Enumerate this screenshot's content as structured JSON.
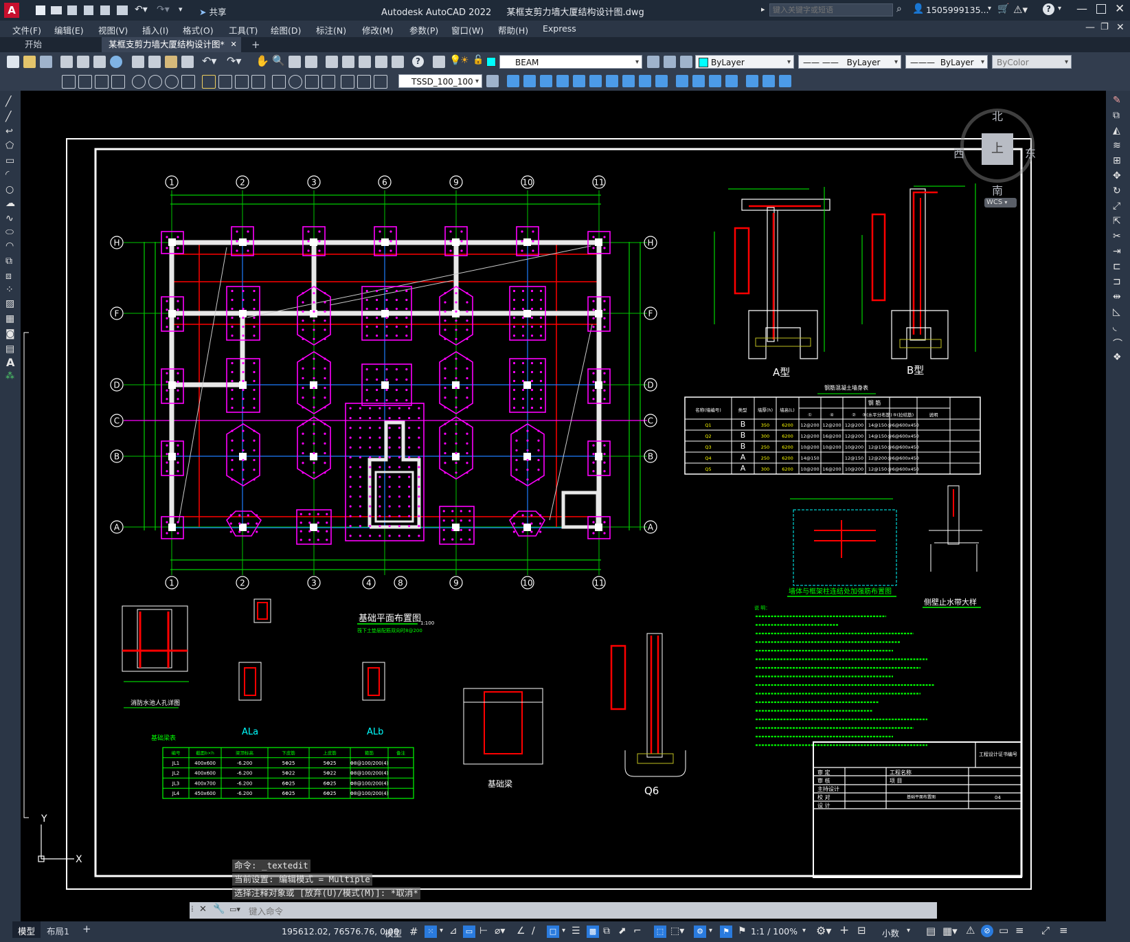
{
  "app": {
    "title": "Autodesk AutoCAD 2022",
    "filename": "某框支剪力墙大厦结构设计图.dwg",
    "search_placeholder": "键入关键字或短语",
    "user": "1505999135...",
    "share": "共享",
    "app_letter": "A"
  },
  "menu": [
    "文件(F)",
    "编辑(E)",
    "视图(V)",
    "插入(I)",
    "格式(O)",
    "工具(T)",
    "绘图(D)",
    "标注(N)",
    "修改(M)",
    "参数(P)",
    "窗口(W)",
    "帮助(H)",
    "Express"
  ],
  "tabs": {
    "start": "开始",
    "active": "某框支剪力墙大厦结构设计图*",
    "add": "+"
  },
  "toolbar": {
    "layer": "BEAM",
    "color": "ByLayer",
    "linetype": "ByLayer",
    "lineweight": "ByLayer",
    "plotstyle": "ByColor",
    "dimstyle": "TSSD_100_100"
  },
  "viewcube": {
    "north": "北",
    "south": "南",
    "east": "东",
    "west": "西",
    "top": "上",
    "wcs": "WCS"
  },
  "drawing": {
    "plan_title": "基础平面布置图",
    "plan_scale": "1:100",
    "plan_note": "筏下土垫层配筋双向时8@200",
    "wall_table_title": "钢筋混凝土墙身表",
    "wall_table_headers": [
      "名称(墙编号)",
      "类型",
      "墙厚(h)",
      "墙高(L)",
      "①",
      "④",
      "②",
      "③(水平分布筋)",
      "⑤(拉结筋)",
      "说明"
    ],
    "wall_table_group": "钢 筋",
    "wall_table_rows": [
      [
        "Q1",
        "B",
        "350",
        "6200",
        "12@200",
        "12@200",
        "12@200",
        "14@150",
        "@6@600x450",
        ""
      ],
      [
        "Q2",
        "B",
        "300",
        "6200",
        "12@200",
        "16@200",
        "12@200",
        "14@150",
        "@6@600x450",
        ""
      ],
      [
        "Q3",
        "B",
        "250",
        "6200",
        "10@200",
        "10@200",
        "10@200",
        "12@150",
        "@6@600x450",
        ""
      ],
      [
        "Q4",
        "A",
        "250",
        "6200",
        "14@150",
        "",
        "12@150",
        "12@200",
        "@6@600x450",
        ""
      ],
      [
        "Q5",
        "A",
        "300",
        "6200",
        "10@200",
        "16@200",
        "10@200",
        "12@150",
        "@6@600x450",
        ""
      ]
    ],
    "beam_table_title": "基础梁表",
    "beam_table_headers": [
      "编号",
      "截面b×h",
      "梁顶标高",
      "下皮筋",
      "上皮筋",
      "箍筋",
      "备注"
    ],
    "beam_table_rows": [
      [
        "JL1",
        "400x600",
        "-6.200",
        "5Φ25",
        "5Φ25",
        "Φ8@100/200(4)",
        ""
      ],
      [
        "JL2",
        "400x600",
        "-6.200",
        "5Φ22",
        "5Φ22",
        "Φ8@100/200(4)",
        ""
      ],
      [
        "JL3",
        "400x700",
        "-6.200",
        "6Φ25",
        "6Φ25",
        "Φ8@100/200(4)",
        ""
      ],
      [
        "JL4",
        "450x600",
        "-6.200",
        "6Φ25",
        "6Φ25",
        "Φ8@100/200(4)",
        ""
      ]
    ],
    "type_a": "A型",
    "type_b": "B型",
    "label_ala": "ALa",
    "label_alb": "ALb",
    "label_q6": "Q6",
    "wall_detail_title": "墙体与框架柱连结处加强筋布置图",
    "waterstop_title": "侧壁止水带大样",
    "foundation_beam_title": "基础梁",
    "fire_pool_title": "消防水池人孔详图",
    "notes_title": "说 明：",
    "grid_top": [
      "1",
      "2",
      "3",
      "6",
      "9",
      "10",
      "11"
    ],
    "grid_bottom": [
      "1",
      "2",
      "3",
      "4",
      "8",
      "9",
      "10",
      "11"
    ],
    "grid_left": [
      "H",
      "F",
      "D",
      "C",
      "B",
      "A"
    ],
    "title_block_rows": [
      "审 定",
      "审 核",
      "主持设计",
      "校 对",
      "设 计"
    ],
    "title_block_project": "工程名称",
    "title_block_item": "项 目",
    "title_block_drawing": "基础平面布置图",
    "title_block_no": "04",
    "title_block_cert": "工程设计证书编号"
  },
  "commands": [
    "命令: _textedit",
    "当前设置: 编辑模式 = Multiple",
    "选择注释对象或 [放弃(U)/模式(M)]: *取消*"
  ],
  "command_placeholder": "键入命令",
  "status": {
    "model_tab": "模型",
    "layout_tab": "布局1",
    "coords": "195612.02, 76576.76, 0.00",
    "model": "模型",
    "scale": "1:1 / 100%",
    "units": "小数"
  },
  "colors": {
    "titlebar": "#1f2a38",
    "panel": "#2b3646",
    "accent": "#2a7bde",
    "cad_white": "#ffffff",
    "cad_green": "#00ff00",
    "cad_red": "#ff0000",
    "cad_magenta": "#ff00ff",
    "cad_cyan": "#00ffff",
    "cad_blue": "#0070ff",
    "cad_yellow": "#ffff00"
  }
}
